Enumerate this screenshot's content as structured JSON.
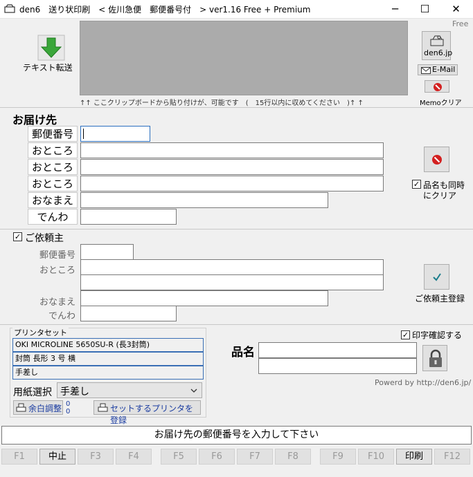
{
  "window": {
    "title": "den6　送り状印刷　< 佐川急便　郵便番号付　> ver1.16 Free + Premium",
    "minimize": "─",
    "maximize": "☐",
    "close": "✕"
  },
  "badge": "Free",
  "toolbar": {
    "text_transfer_label": "テキスト転送",
    "clipboard_hint": "↑↑ ここクリップボードから貼り付けが、可能です　(　15行以内に収めてください　)↑ ↑",
    "den6_link": "den6.jp",
    "email_label": "E-Mail",
    "memo_clear_label": "Memoクリア"
  },
  "delivery": {
    "section_title": "お届け先",
    "postal_label": "郵便番号",
    "address1_label": "おところ①",
    "address2_label": "おところ②",
    "address3_label": "おところ③",
    "name_label": "おなまえ",
    "phone_label": "でんわ",
    "clear_items_label_1": "品名も同時",
    "clear_items_label_2": "にクリア"
  },
  "sender": {
    "section_title": "ご依頼主",
    "postal_label": "郵便番号",
    "address_label": "おところ",
    "name_label": "おなまえ",
    "phone_label": "でんわ",
    "register_label": "ご依頼主登録"
  },
  "printer": {
    "legend": "プリンタセット",
    "printer_name": "OKI MICROLINE 5650SU-R (長3封筒)",
    "envelope": "封筒 長形 3 号 横",
    "feed": "手差し",
    "paper_select_label": "用紙選択",
    "paper_select_value": "手差し",
    "margin_button": "余白調整",
    "margin_x": "0",
    "margin_y": "0",
    "register_printer_button": "セットするプリンタを登録"
  },
  "items": {
    "print_confirm_label": "印字確認する",
    "item_name_label": "品名",
    "powered_by": "Powerd by http://den6.jp/"
  },
  "status_message": "お届け先の郵便番号を入力して下さい",
  "fkeys": {
    "f1": "F1",
    "f2": "中止",
    "f3": "F3",
    "f4": "F4",
    "f5": "F5",
    "f6": "F6",
    "f7": "F7",
    "f8": "F8",
    "f9": "F9",
    "f10": "F10",
    "f11": "印刷",
    "f12": "F12"
  },
  "colors": {
    "accent": "#2a6fbf",
    "arrow_green": "#3aa63a",
    "check_teal": "#1a7d8c"
  }
}
